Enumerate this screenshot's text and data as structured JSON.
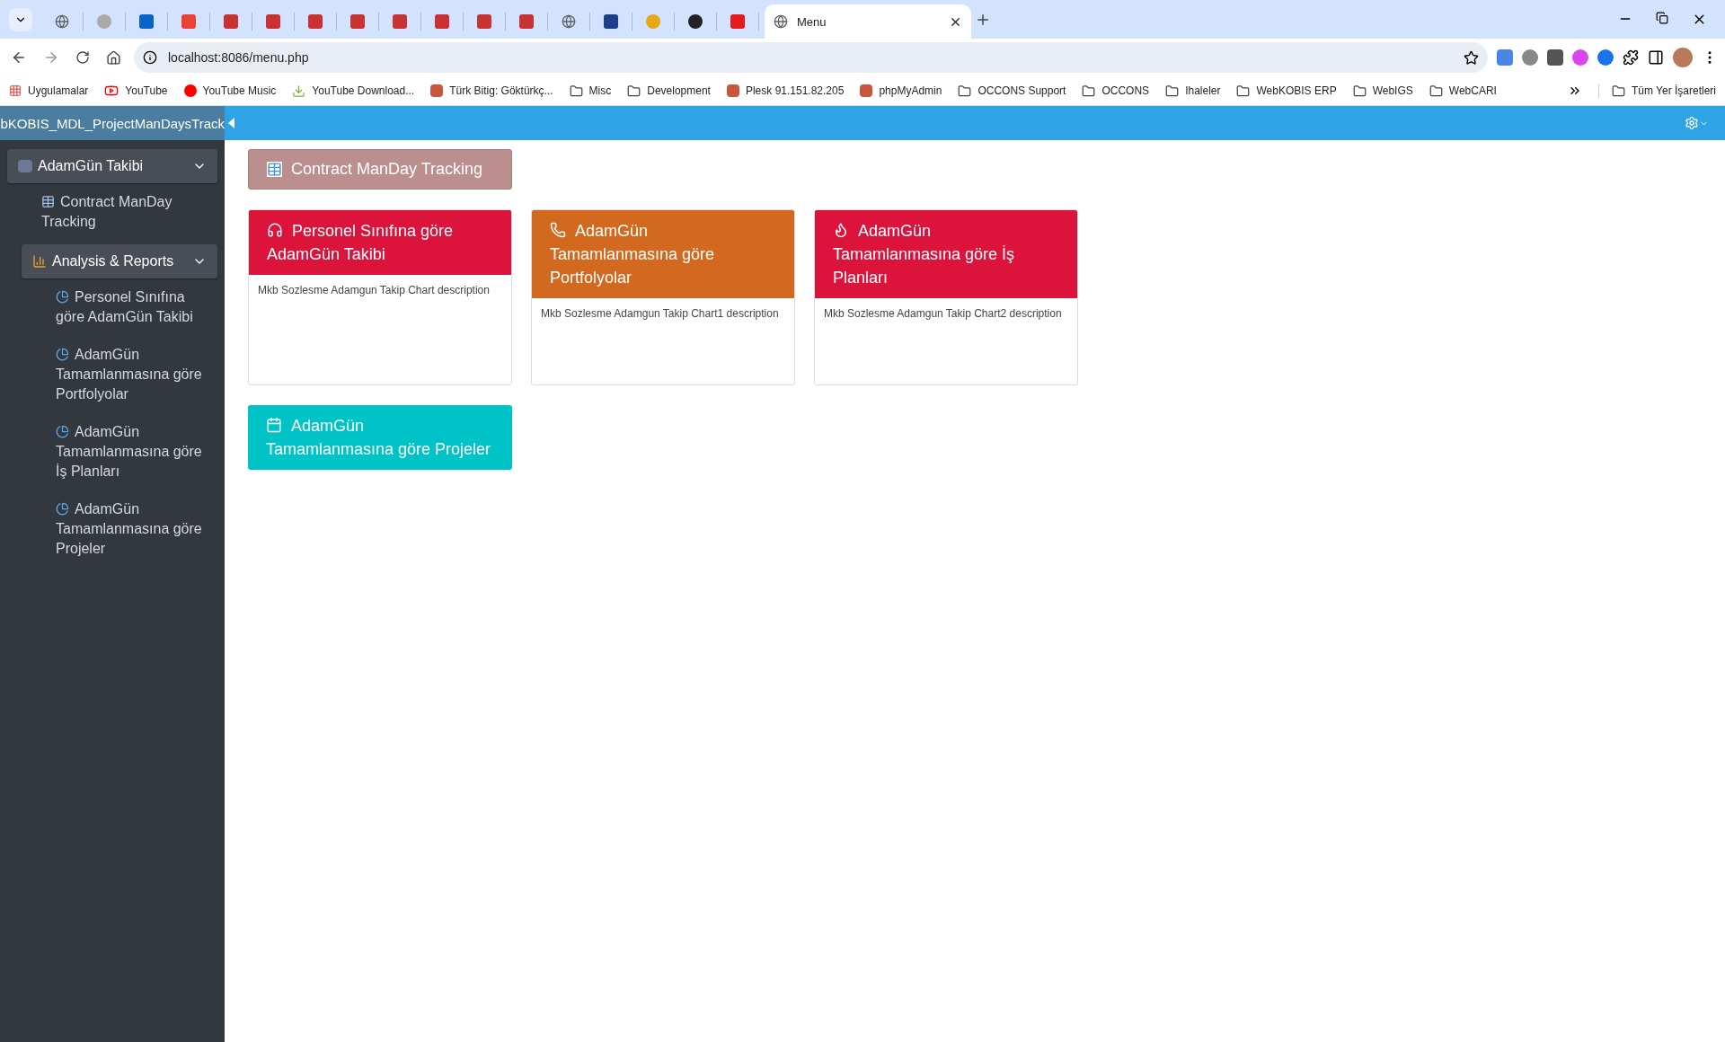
{
  "browser": {
    "tabs": [
      {
        "kind": "globe",
        "selected": false
      },
      {
        "kind": "dot",
        "selected": false
      },
      {
        "kind": "mail",
        "selected": false
      },
      {
        "kind": "gmail",
        "selected": false
      },
      {
        "kind": "logo",
        "selected": false
      },
      {
        "kind": "logo",
        "selected": false
      },
      {
        "kind": "logo",
        "selected": false
      },
      {
        "kind": "logo",
        "selected": false
      },
      {
        "kind": "logo",
        "selected": false
      },
      {
        "kind": "logo",
        "selected": false
      },
      {
        "kind": "logo",
        "selected": false
      },
      {
        "kind": "logo",
        "selected": false
      },
      {
        "kind": "globe",
        "selected": false
      },
      {
        "kind": "tool",
        "selected": false
      },
      {
        "kind": "animal",
        "selected": false
      },
      {
        "kind": "gauge",
        "selected": false
      },
      {
        "kind": "bracket",
        "selected": false
      },
      {
        "kind": "page",
        "title": "Menu",
        "selected": true
      }
    ],
    "url": "localhost:8086/menu.php",
    "bookmarks": [
      {
        "kind": "apps",
        "label": "Uygulamalar"
      },
      {
        "kind": "video",
        "label": "YouTube"
      },
      {
        "kind": "music",
        "label": "YouTube Music"
      },
      {
        "kind": "download",
        "label": "YouTube Download..."
      },
      {
        "kind": "site",
        "label": "Türk Bitig: Göktürkç..."
      },
      {
        "kind": "folder",
        "label": "Misc"
      },
      {
        "kind": "folder",
        "label": "Development"
      },
      {
        "kind": "site",
        "label": "Plesk 91.151.82.205"
      },
      {
        "kind": "site",
        "label": "phpMyAdmin"
      },
      {
        "kind": "folder",
        "label": "OCCONS Support"
      },
      {
        "kind": "folder",
        "label": "OCCONS"
      },
      {
        "kind": "folder",
        "label": "Ihaleler"
      },
      {
        "kind": "folder",
        "label": "WebKOBIS ERP"
      },
      {
        "kind": "folder",
        "label": "WebIGS"
      },
      {
        "kind": "folder",
        "label": "WebCARI"
      }
    ],
    "all_bookmarks": "Tüm Yer İşaretleri"
  },
  "app": {
    "title": "bKOBIS_MDL_ProjectManDaysTrack"
  },
  "sidebar": {
    "items": [
      {
        "kind": "group",
        "label": "AdamGün Takibi",
        "expanded": true,
        "children": [
          {
            "kind": "link",
            "label": "Contract ManDay Tracking"
          },
          {
            "kind": "group",
            "label": "Analysis & Reports",
            "expanded": true,
            "children": [
              {
                "kind": "link",
                "label": "Personel Sınıfına göre AdamGün Takibi"
              },
              {
                "kind": "link",
                "label": "AdamGün Tamamlanmasına göre Portfolyolar"
              },
              {
                "kind": "link",
                "label": "AdamGün Tamamlanmasına göre İş Planları"
              },
              {
                "kind": "link",
                "label": "AdamGün Tamamlanmasına göre Projeler"
              }
            ]
          }
        ]
      }
    ]
  },
  "page_button": {
    "label": "Contract ManDay Tracking"
  },
  "cards": [
    {
      "kind": "panel",
      "title": "Personel Sınıfına göre AdamGün Takibi",
      "color": "#dc143c",
      "description": "Mkb Sozlesme Adamgun Takip Chart description"
    },
    {
      "kind": "panel",
      "title": "AdamGün Tamamlanmasına göre Portfolyolar",
      "color": "#d2691e",
      "description": "Mkb Sozlesme Adamgun Takip Chart1 description"
    },
    {
      "kind": "panel",
      "title": "AdamGün Tamamlanmasına göre İş Planları",
      "color": "#dc143c",
      "description": "Mkb Sozlesme Adamgun Takip Chart2 description"
    },
    {
      "kind": "tile",
      "title": "AdamGün Tamamlanmasına göre Projeler",
      "color": "#00c3c8"
    }
  ]
}
